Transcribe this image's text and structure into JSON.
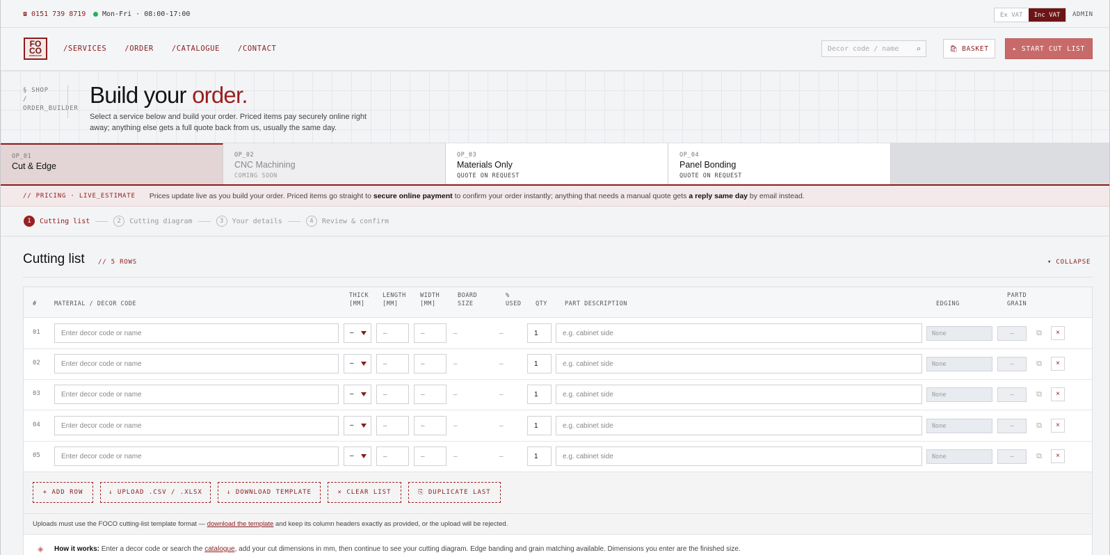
{
  "topbar": {
    "phone": "☎ 0151 739 8719",
    "hours": "Mon-Fri · 08:00-17:00",
    "vat_ex": "Ex VAT",
    "vat_inc": "Inc VAT",
    "admin": "ADMIN"
  },
  "nav": {
    "logo_text": "FO CO",
    "logo_sub": "WORKSHOP",
    "links": [
      "/SERVICES",
      "/ORDER",
      "/CATALOGUE",
      "/CONTACT"
    ],
    "search_placeholder": "Decor code / name",
    "basket": "BASKET",
    "start_cut_list": "▸ START CUT LIST"
  },
  "hero": {
    "breadcrumb_1": "§ SHOP",
    "breadcrumb_sep": "/",
    "breadcrumb_2": "ORDER_BUILDER",
    "title_main": "Build your ",
    "title_accent": "order.",
    "subtitle": "Select a service below and build your order. Priced items pay securely online right away; anything else gets a full quote back from us, usually the same day."
  },
  "tabs": [
    {
      "code": "OP_01",
      "name": "Cut & Edge",
      "tag": ""
    },
    {
      "code": "OP_02",
      "name": "CNC Machining",
      "tag": "COMING SOON"
    },
    {
      "code": "OP_03",
      "name": "Materials Only",
      "tag": "QUOTE ON REQUEST"
    },
    {
      "code": "OP_04",
      "name": "Panel Bonding",
      "tag": "QUOTE ON REQUEST"
    }
  ],
  "pricing": {
    "label": "// PRICING · LIVE_ESTIMATE",
    "text_1": "Prices update live as you build your order. Priced items go straight to ",
    "bold_1": "secure online payment",
    "text_2": " to confirm your order instantly; anything that needs a manual quote gets ",
    "bold_2": "a reply same day",
    "text_3": " by email instead."
  },
  "steps": [
    {
      "num": "1",
      "label": "Cutting list"
    },
    {
      "num": "2",
      "label": "Cutting diagram"
    },
    {
      "num": "3",
      "label": "Your details"
    },
    {
      "num": "4",
      "label": "Review & confirm"
    }
  ],
  "cutting_list": {
    "title": "Cutting list",
    "rows_count": "// 5 ROWS",
    "collapse": "▾ COLLAPSE",
    "headers": {
      "num": "#",
      "material": "MATERIAL / DECOR CODE",
      "thick_1": "THICK",
      "thick_2": "[MM]",
      "length_1": "LENGTH",
      "length_2": "[MM]",
      "width_1": "WIDTH",
      "width_2": "[MM]",
      "board_1": "BOARD",
      "board_2": "SIZE",
      "used_1": "%",
      "used_2": "USED",
      "qty": "QTY",
      "desc": "PART DESCRIPTION",
      "edging": "EDGING",
      "grain_1": "PARTD",
      "grain_2": "GRAIN"
    },
    "rows": [
      {
        "num": "01",
        "material_placeholder": "Enter decor code or name",
        "thick": "–",
        "length": "–",
        "width": "–",
        "board": "–",
        "used": "–",
        "qty": "1",
        "desc_placeholder": "e.g. cabinet side",
        "edging": "None",
        "grain": "–",
        "delete": "×"
      },
      {
        "num": "02",
        "material_placeholder": "Enter decor code or name",
        "thick": "–",
        "length": "–",
        "width": "–",
        "board": "–",
        "used": "–",
        "qty": "1",
        "desc_placeholder": "e.g. cabinet side",
        "edging": "None",
        "grain": "–",
        "delete": "×"
      },
      {
        "num": "03",
        "material_placeholder": "Enter decor code or name",
        "thick": "–",
        "length": "–",
        "width": "–",
        "board": "–",
        "used": "–",
        "qty": "1",
        "desc_placeholder": "e.g. cabinet side",
        "edging": "None",
        "grain": "–",
        "delete": "×"
      },
      {
        "num": "04",
        "material_placeholder": "Enter decor code or name",
        "thick": "–",
        "length": "–",
        "width": "–",
        "board": "–",
        "used": "–",
        "qty": "1",
        "desc_placeholder": "e.g. cabinet side",
        "edging": "None",
        "grain": "–",
        "delete": "×"
      },
      {
        "num": "05",
        "material_placeholder": "Enter decor code or name",
        "thick": "–",
        "length": "–",
        "width": "–",
        "board": "–",
        "used": "–",
        "qty": "1",
        "desc_placeholder": "e.g. cabinet side",
        "edging": "None",
        "grain": "–",
        "delete": "×"
      }
    ],
    "actions": [
      "+ ADD ROW",
      "↓ UPLOAD .CSV / .XLSX",
      "↓ DOWNLOAD TEMPLATE",
      "× CLEAR LIST",
      "⎘ DUPLICATE LAST"
    ],
    "note": {
      "text_1": "Uploads must use the FOCO cutting-list template format — ",
      "link": "download the template",
      "text_2": " and keep its column headers exactly as provided, or the upload will be rejected."
    },
    "how": {
      "label": "How it works:",
      "text_1": " Enter a decor code or search the ",
      "link": "catalogue",
      "text_2": ", add your cut dimensions in mm, then continue to see your cutting diagram. Edge banding and grain matching available. Dimensions you enter are the finished size."
    }
  },
  "colors": {
    "accent": "#8b1c1c",
    "accent_light": "#c96a6a",
    "banner_bg": "#f4e9ea"
  }
}
